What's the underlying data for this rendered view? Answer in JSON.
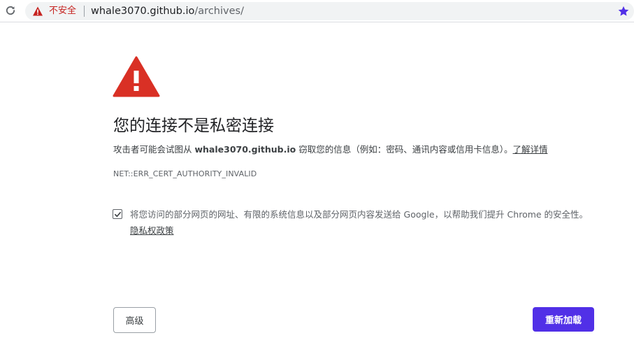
{
  "browser": {
    "security_label": "不安全",
    "url_host": "whale3070.github.io",
    "url_path": "/archives/",
    "accent_color": "#5130e7",
    "warning_color": "#c5221f"
  },
  "interstitial": {
    "heading": "您的连接不是私密连接",
    "desc_prefix": "攻击者可能会试图从 ",
    "desc_host": "whale3070.github.io",
    "desc_suffix": " 窃取您的信息（例如：密码、通讯内容或信用卡信息）。",
    "learn_more": "了解详情",
    "error_code": "NET::ERR_CERT_AUTHORITY_INVALID",
    "report_checked": true,
    "report_prefix": "将",
    "report_link": "您访问的部分网页的网址、有限的系统信息以及部分网页内容",
    "report_suffix": "发送给 Google，以帮助我们提升 Chrome 的安全性。",
    "privacy_link": "隐私权政策",
    "advanced_button": "高级",
    "reload_button": "重新加载"
  }
}
